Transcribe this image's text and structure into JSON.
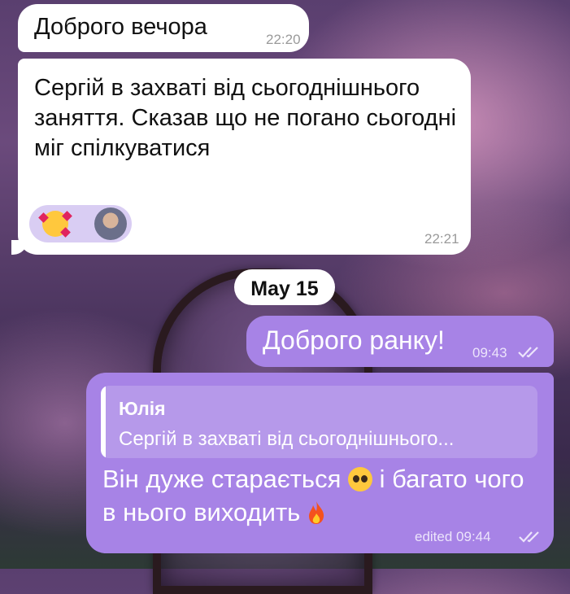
{
  "messages": [
    {
      "text": "Доброго вечора",
      "time": "22:20"
    },
    {
      "text": "Сергій в захваті від сьогоднішнього заняття. Сказав що не погано сьогодні міг спілкуватися",
      "time": "22:21",
      "reactions": [
        "smiling-face-with-hearts-icon",
        "user-avatar"
      ]
    },
    {
      "text": "Доброго ранку!",
      "time": "09:43"
    },
    {
      "reply_to": {
        "name": "Юлія",
        "text": "Сергій в захваті від сьогоднішнього..."
      },
      "text_part1": "Він дуже старається",
      "text_part2": " і багато чого в нього виходить",
      "time": "edited 09:44"
    }
  ],
  "date_separator": "May 15",
  "colors": {
    "outgoing": "#a783e6",
    "incoming": "#ffffff",
    "reaction_bg": "#d9cdf3"
  }
}
